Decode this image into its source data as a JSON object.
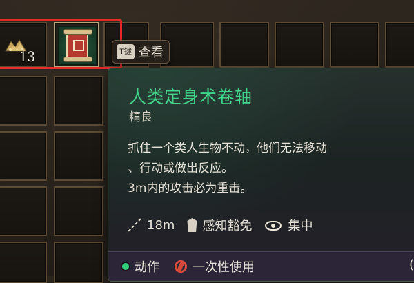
{
  "inventory": {
    "selected_slot_index": 1,
    "slots_top_row": [
      {
        "item": "gold-coins",
        "count": "13"
      },
      {
        "item": "spell-scroll",
        "count": ""
      },
      {
        "item": "",
        "count": ""
      },
      {
        "item": "",
        "count": ""
      },
      {
        "item": "",
        "count": ""
      },
      {
        "item": "",
        "count": ""
      },
      {
        "item": "",
        "count": ""
      },
      {
        "item": "",
        "count": ""
      }
    ]
  },
  "hint": {
    "key": "T键",
    "label": "查看"
  },
  "tooltip": {
    "title": "人类定身术卷轴",
    "rarity": "精良",
    "description_lines": [
      "抓住一个类人生物不动，他们无法移动",
      "、行动或做出反应。",
      "3m内的攻击必为重击。"
    ],
    "stats": {
      "range": "18m",
      "save": "感知豁免",
      "concentration": "集中"
    },
    "footer": {
      "action_type": "动作",
      "usage": "一次性使用",
      "right_partial": "("
    },
    "colors": {
      "title": "#41d38a",
      "highlight": "#e52a2a",
      "action_dot": "#30d07a",
      "once_icon": "#d84a3a"
    },
    "icons": {
      "range": "range-icon",
      "save": "save-icon",
      "concentration": "eye-icon",
      "action": "action-dot-icon",
      "once": "single-use-icon"
    }
  }
}
